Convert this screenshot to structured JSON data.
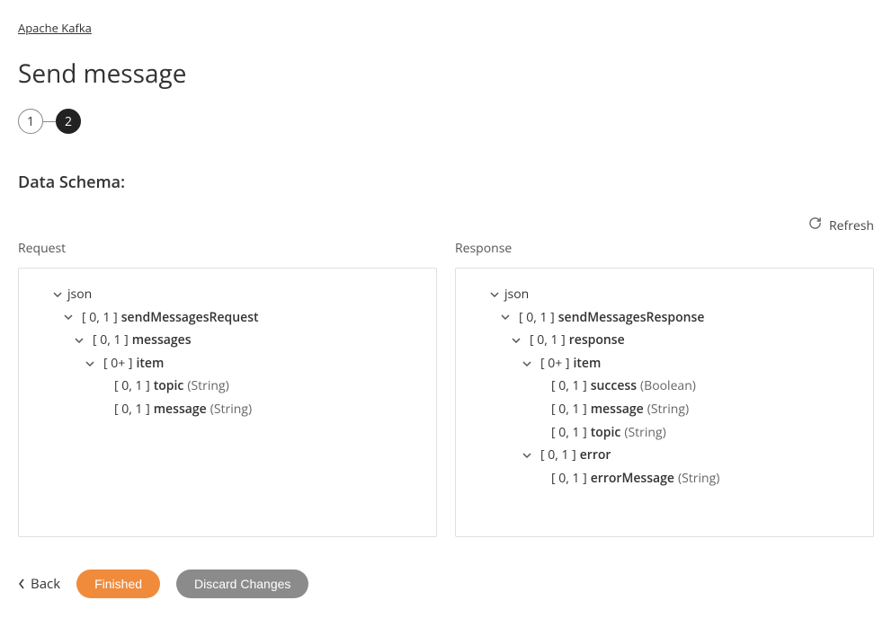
{
  "breadcrumb": "Apache Kafka",
  "page_title": "Send message",
  "stepper": {
    "step1": "1",
    "step2": "2"
  },
  "section_heading": "Data Schema:",
  "refresh_label": "Refresh",
  "request_label": "Request",
  "response_label": "Response",
  "request_tree": {
    "root": "json",
    "n1": {
      "card": "[ 0, 1 ]",
      "name": "sendMessagesRequest"
    },
    "n2": {
      "card": "[ 0, 1 ]",
      "name": "messages"
    },
    "n3": {
      "card": "[ 0+ ]",
      "name": "item"
    },
    "n4": {
      "card": "[ 0, 1 ]",
      "name": "topic",
      "type": "(String)"
    },
    "n5": {
      "card": "[ 0, 1 ]",
      "name": "message",
      "type": "(String)"
    }
  },
  "response_tree": {
    "root": "json",
    "n1": {
      "card": "[ 0, 1 ]",
      "name": "sendMessagesResponse"
    },
    "n2": {
      "card": "[ 0, 1 ]",
      "name": "response"
    },
    "n3": {
      "card": "[ 0+ ]",
      "name": "item"
    },
    "n4": {
      "card": "[ 0, 1 ]",
      "name": "success",
      "type": "(Boolean)"
    },
    "n5": {
      "card": "[ 0, 1 ]",
      "name": "message",
      "type": "(String)"
    },
    "n6": {
      "card": "[ 0, 1 ]",
      "name": "topic",
      "type": "(String)"
    },
    "n7": {
      "card": "[ 0, 1 ]",
      "name": "error"
    },
    "n8": {
      "card": "[ 0, 1 ]",
      "name": "errorMessage",
      "type": "(String)"
    }
  },
  "footer": {
    "back": "Back",
    "finished": "Finished",
    "discard": "Discard Changes"
  }
}
